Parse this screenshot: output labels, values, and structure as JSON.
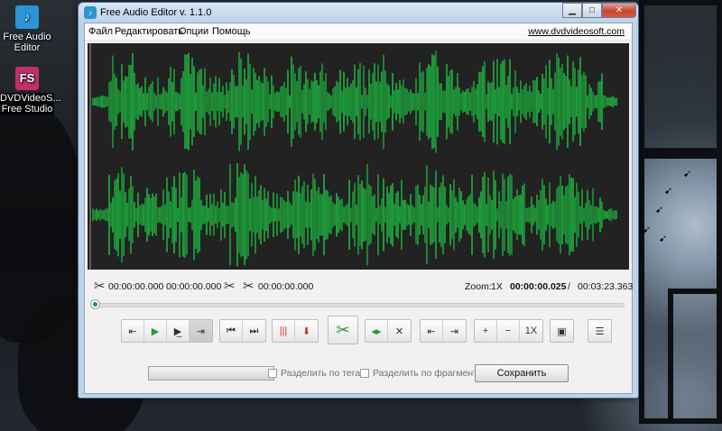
{
  "desktop": {
    "icons": [
      {
        "label": "Free Audio Editor",
        "glyph": "♪",
        "color": "#2b94d4",
        "selected": false
      },
      {
        "label": "DVDVideoS... Free Studio",
        "glyph": "FS",
        "color": "#c0306a",
        "selected": true
      }
    ]
  },
  "window": {
    "title": "Free Audio Editor v. 1.1.0",
    "caption_buttons": {
      "minimize": "▁",
      "maximize": "□",
      "close": "✕"
    },
    "menu": [
      "Файл",
      "Редактировать",
      "Опции",
      "Помощь"
    ],
    "site_link": "www.dvdvideosoft.com"
  },
  "waveform": {
    "color": "#1e9b3a",
    "background": "#222222",
    "channels": 2
  },
  "times": {
    "selection_start": "00:00:00.000",
    "selection_end": "00:00:00.000",
    "cut_time": "00:00:00.000",
    "zoom_label": "Zoom:",
    "zoom_value": "1X",
    "position": "00:00:00.025",
    "separator": "/",
    "duration": "00:03:23.363"
  },
  "seek": {
    "progress": 0.0
  },
  "toolbar": {
    "groups": [
      [
        {
          "icon": "rewind-icon",
          "glyph": "⇤"
        },
        {
          "icon": "play-icon",
          "glyph": "▶",
          "color": "#1e9b3a"
        },
        {
          "icon": "play-to-end-icon",
          "glyph": "▶̲"
        },
        {
          "icon": "forward-icon",
          "glyph": "⇥",
          "pressed": true
        }
      ],
      [
        {
          "icon": "skip-back-icon",
          "glyph": "⏮"
        },
        {
          "icon": "skip-forward-icon",
          "glyph": "⏭"
        }
      ],
      [
        {
          "icon": "split-markers-icon",
          "glyph": "|||",
          "color": "#d03030"
        },
        {
          "icon": "insert-marker-icon",
          "glyph": "⬇",
          "color": "#d03030"
        }
      ],
      [
        {
          "icon": "cut-icon",
          "glyph": "✂",
          "color": "#1e9b3a"
        }
      ],
      [
        {
          "icon": "cut-left-icon",
          "glyph": "◂▸",
          "color": "#1e9b3a"
        },
        {
          "icon": "delete-selection-icon",
          "glyph": "✕"
        }
      ],
      [
        {
          "icon": "go-to-start-icon",
          "glyph": "⇤"
        },
        {
          "icon": "go-to-end-icon",
          "glyph": "⇥"
        }
      ],
      [
        {
          "icon": "zoom-in-icon",
          "glyph": "+"
        },
        {
          "icon": "zoom-out-icon",
          "glyph": "−"
        },
        {
          "icon": "zoom-1x-icon",
          "glyph": "1X"
        }
      ],
      [
        {
          "icon": "image-icon",
          "glyph": "▣"
        }
      ],
      [
        {
          "icon": "settings-sliders-icon",
          "glyph": "☰"
        }
      ]
    ]
  },
  "bottom": {
    "split_by_tags": "Разделить по тегам",
    "split_by_fragments": "Разделить по фрагментам",
    "save": "Сохранить"
  }
}
